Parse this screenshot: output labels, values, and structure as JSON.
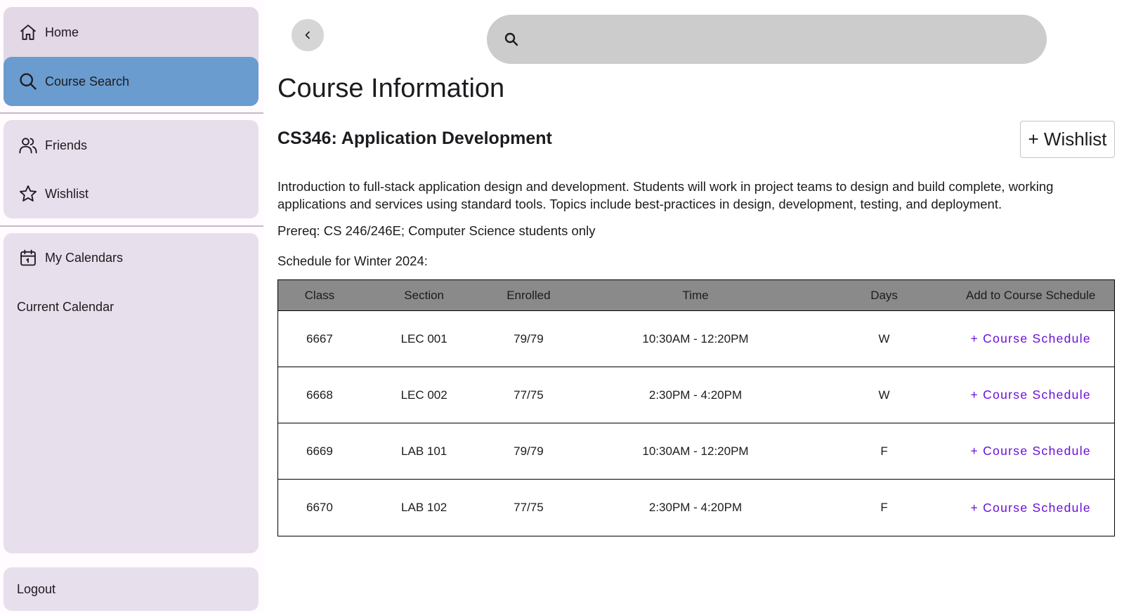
{
  "sidebar": {
    "items": [
      {
        "label": "Home",
        "icon": "home-icon"
      },
      {
        "label": "Course Search",
        "icon": "search-icon"
      },
      {
        "label": "Friends",
        "icon": "people-icon"
      },
      {
        "label": "Wishlist",
        "icon": "star-icon"
      },
      {
        "label": "My Calendars",
        "icon": "calendar-icon"
      },
      {
        "label": "Current Calendar"
      },
      {
        "label": "Logout"
      }
    ],
    "active_color": "#6a9ccf"
  },
  "search": {
    "placeholder": "",
    "value": ""
  },
  "main": {
    "page_title": "Course Information",
    "course_title": "CS346: Application Development",
    "wishlist_button": "+ Wishlist",
    "description": "Introduction to full-stack application design and development. Students will work in project teams to design and build complete, working applications and services using standard tools. Topics include best-practices in design, development, testing, and deployment.",
    "prereq": "Prereq: CS 246/246E; Computer Science students only",
    "schedule_label": "Schedule for Winter 2024:"
  },
  "table": {
    "headers": [
      "Class",
      "Section",
      "Enrolled",
      "Time",
      "Days",
      "Add to Course Schedule"
    ],
    "rows": [
      {
        "class": "6667",
        "section": "LEC 001",
        "enrolled": "79/79",
        "time": "10:30AM - 12:20PM",
        "days": "W",
        "action": "+ Course Schedule"
      },
      {
        "class": "6668",
        "section": "LEC 002",
        "enrolled": "77/75",
        "time": "2:30PM - 4:20PM",
        "days": "W",
        "action": "+ Course Schedule"
      },
      {
        "class": "6669",
        "section": "LAB 101",
        "enrolled": "79/79",
        "time": "10:30AM - 12:20PM",
        "days": "F",
        "action": "+ Course Schedule"
      },
      {
        "class": "6670",
        "section": "LAB 102",
        "enrolled": "77/75",
        "time": "2:30PM - 4:20PM",
        "days": "F",
        "action": "+ Course Schedule"
      }
    ],
    "link_color": "#6a0fd6",
    "header_color": "#8a8a8a"
  }
}
